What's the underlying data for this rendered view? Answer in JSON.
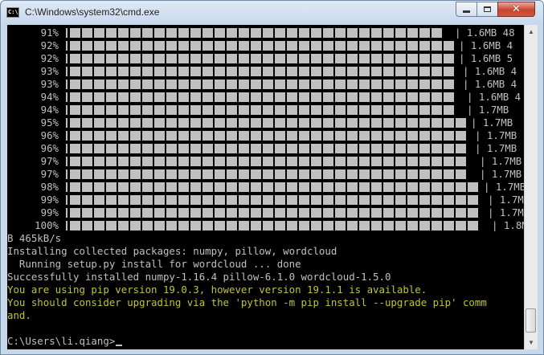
{
  "window": {
    "title": "C:\\Windows\\system32\\cmd.exe",
    "icon_text": "C:\\",
    "buttons": {
      "minimize": "minimize-icon",
      "maximize": "maximize-icon",
      "close": "close-icon"
    }
  },
  "progress_rows": [
    {
      "percent": "91%",
      "fraction": 0.91,
      "info": "| 1.6MB 48"
    },
    {
      "percent": "92%",
      "fraction": 0.92,
      "info": "| 1.6MB 4"
    },
    {
      "percent": "92%",
      "fraction": 0.92,
      "info": "| 1.6MB 5"
    },
    {
      "percent": "93%",
      "fraction": 0.93,
      "info": "| 1.6MB 4"
    },
    {
      "percent": "93%",
      "fraction": 0.93,
      "info": "| 1.6MB 4"
    },
    {
      "percent": "94%",
      "fraction": 0.94,
      "info": "| 1.6MB 4"
    },
    {
      "percent": "94%",
      "fraction": 0.94,
      "info": "| 1.7MB"
    },
    {
      "percent": "95%",
      "fraction": 0.95,
      "info": "| 1.7MB"
    },
    {
      "percent": "96%",
      "fraction": 0.96,
      "info": "| 1.7MB"
    },
    {
      "percent": "96%",
      "fraction": 0.96,
      "info": "| 1.7MB"
    },
    {
      "percent": "97%",
      "fraction": 0.97,
      "info": "| 1.7MB"
    },
    {
      "percent": "97%",
      "fraction": 0.97,
      "info": "| 1.7MB"
    },
    {
      "percent": "98%",
      "fraction": 0.98,
      "info": "| 1.7MB"
    },
    {
      "percent": "99%",
      "fraction": 0.99,
      "info": "| 1.7MB"
    },
    {
      "percent": "99%",
      "fraction": 0.99,
      "info": "| 1.7MB"
    },
    {
      "percent": "100%",
      "fraction": 1.0,
      "info": "| 1.8M"
    }
  ],
  "output_lines": [
    {
      "text": "B 465kB/s",
      "color": "#c0c0c0"
    },
    {
      "text": "Installing collected packages: numpy, pillow, wordcloud",
      "color": "#c0c0c0"
    },
    {
      "text": "  Running setup.py install for wordcloud ... done",
      "color": "#c0c0c0"
    },
    {
      "text": "Successfully installed numpy-1.16.4 pillow-6.1.0 wordcloud-1.5.0",
      "color": "#c0c0c0"
    },
    {
      "text": "You are using pip version 19.0.3, however version 19.1.1 is available.",
      "color": "#c2c23e"
    },
    {
      "text": "You should consider upgrading via the 'python -m pip install --upgrade pip' comm",
      "color": "#c2c23e"
    },
    {
      "text": "and.",
      "color": "#c2c23e"
    },
    {
      "text": "",
      "color": "#c0c0c0"
    }
  ],
  "prompt": "C:\\Users\\li.qiang>",
  "scrollbar": {
    "up": "scroll-up-arrow-icon",
    "down": "scroll-down-arrow-icon",
    "position": 0.92
  },
  "colors": {
    "console_bg": "#000000",
    "console_text": "#c0c0c0",
    "warning_text": "#c2c23e"
  }
}
